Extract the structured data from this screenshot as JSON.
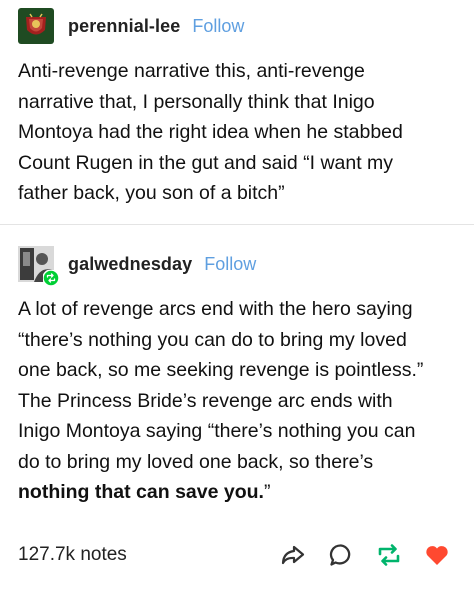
{
  "posts": [
    {
      "username": "perennial-lee",
      "follow_label": "Follow",
      "avatar_icon": "rose-emblem-avatar",
      "lines": [
        "Anti-revenge narrative this, anti-revenge",
        "narrative that, I personally think that Inigo",
        "Montoya had the right idea when he stabbed",
        "Count Rugen in the gut and said “I want my",
        "father back, you son of a bitch”"
      ]
    },
    {
      "username": "galwednesday",
      "follow_label": "Follow",
      "avatar_icon": "photo-avatar-with-reblog-badge",
      "lines": [
        "A lot of revenge arcs end with the hero saying",
        "“there’s nothing you can do to bring my loved",
        "one back, so me seeking revenge is pointless.”",
        "The Princess Bride’s revenge arc ends with",
        "Inigo Montoya saying “there’s nothing you can",
        "do to bring my loved one back, so there’s"
      ],
      "bold_line": "nothing that can save you.",
      "bold_line_suffix": "”"
    }
  ],
  "footer": {
    "notes": "127.7k notes",
    "actions": [
      "share-icon",
      "reply-icon",
      "reblog-icon",
      "like-icon"
    ]
  },
  "colors": {
    "follow": "#5f9fe0",
    "reblog": "#00b46c",
    "like": "#ff4930",
    "reblog_badge": "#00cf35"
  }
}
